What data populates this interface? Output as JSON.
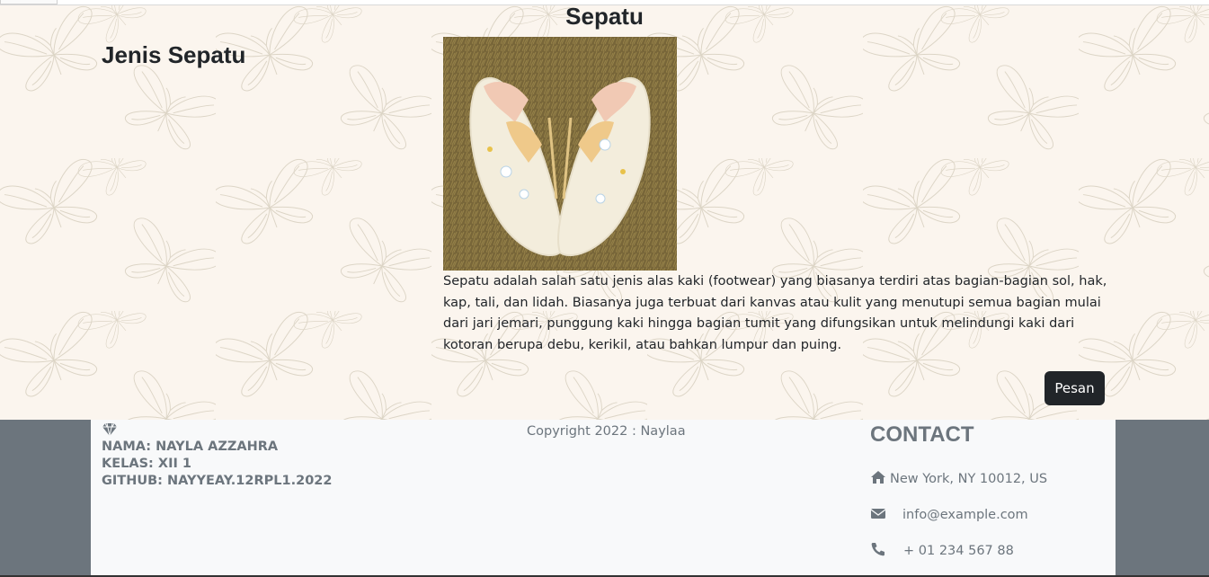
{
  "header": {
    "title": "Sepatu"
  },
  "main": {
    "side_title": "Jenis Sepatu",
    "image_alt": "Sepatu",
    "description": "Sepatu adalah salah satu jenis alas kaki (footwear) yang biasanya terdiri atas bagian-bagian sol, hak, kap, tali, dan lidah. Biasanya juga terbuat dari kanvas atau kulit yang menutupi semua bagian mulai dari jari jemari, punggung kaki hingga bagian tumit yang difungsikan untuk melindungi kaki dari kotoran berupa debu, kerikil, atau bahkan lumpur dan puing.",
    "order_button": "Pesan"
  },
  "footer": {
    "icon": "diamond-icon",
    "name": "NAMA: NAYLA AZZAHRA",
    "class": "KELAS: XII 1",
    "github": "GITHUB: NAYYEAY.12RPL1.2022",
    "copyright": "Copyright 2022 : Naylaa",
    "contact_title": "CONTACT",
    "address": "New York, NY 10012, US",
    "email": "info@example.com",
    "phone": "+ 01 234 567 88"
  },
  "colors": {
    "background": "#fbf5ee",
    "footer_side": "#6c757d",
    "footer_bg": "#f8f9fa",
    "button": "#212529",
    "muted_text": "#6c757d"
  }
}
